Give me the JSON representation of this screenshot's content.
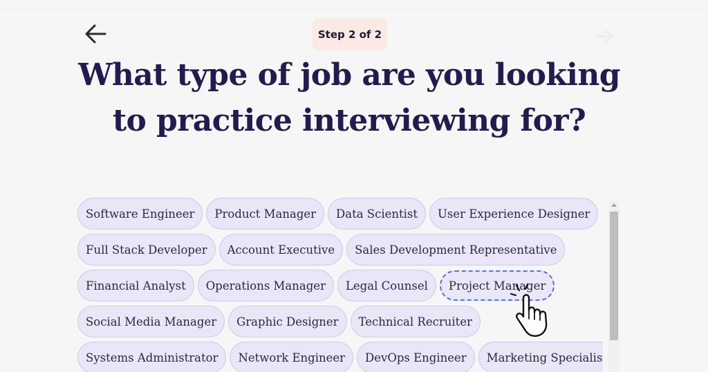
{
  "header": {
    "back_icon": "arrow-left-icon",
    "forward_icon": "arrow-right-icon",
    "step_label": "Step 2 of 2"
  },
  "question": {
    "title": "What type of job are you looking to practice interviewing for?"
  },
  "job_options": {
    "rows": [
      [
        "Software Engineer",
        "Product Manager",
        "Data Scientist",
        "User Experience Designer"
      ],
      [
        "Full Stack Developer",
        "Account Executive",
        "Sales Development Representative"
      ],
      [
        "Financial Analyst",
        "Operations Manager",
        "Legal Counsel",
        "Project Manager"
      ],
      [
        "Social Media Manager",
        "Graphic Designer",
        "Technical Recruiter"
      ],
      [
        "Systems Administrator",
        "Network Engineer",
        "DevOps Engineer",
        "Marketing Specialist"
      ]
    ],
    "focused": "Project Manager"
  },
  "colors": {
    "background": "#f6f6f6",
    "heading": "#221c4e",
    "chip_fill": "#e8e6f7",
    "chip_border": "#cfcbea",
    "focus_ring": "#5a6ee0",
    "step_badge": "#fbe9e5"
  },
  "cursor": {
    "icon": "pointer-hand-icon"
  }
}
